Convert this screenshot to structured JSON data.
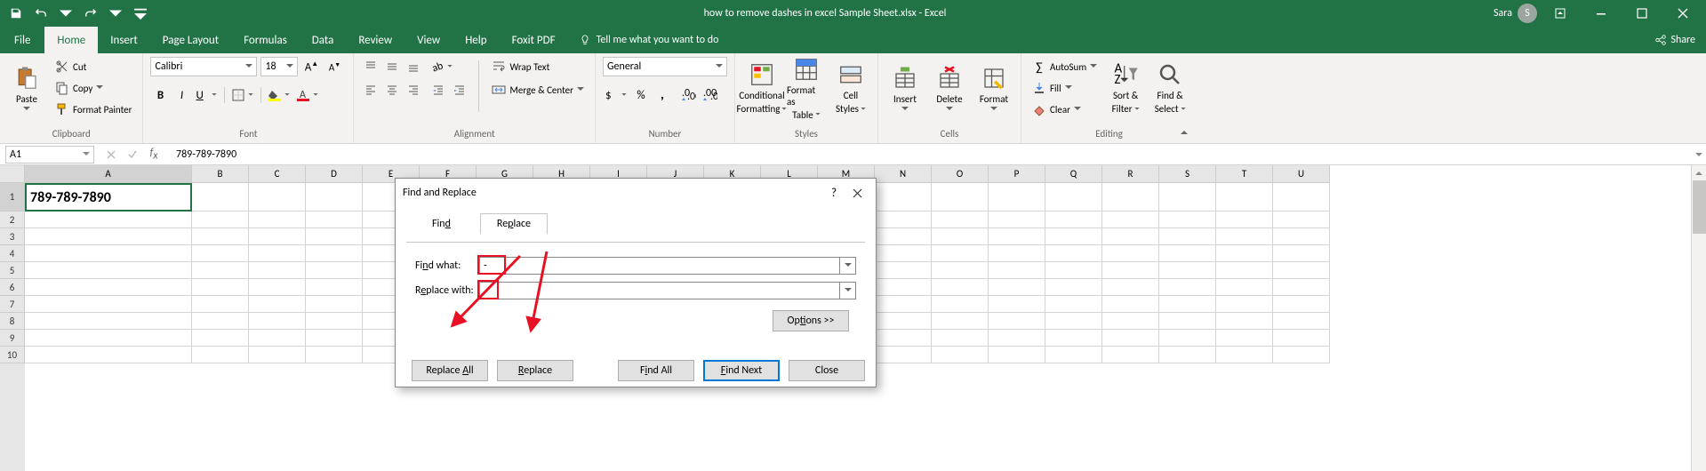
{
  "title": {
    "doc_name": "how to remove dashes in excel Sample Sheet.xlsx",
    "app_name": "Excel",
    "full": "how to remove dashes in excel Sample Sheet.xlsx  -  Excel"
  },
  "user": {
    "name": "Sara",
    "initial": "S"
  },
  "qat": {
    "save": "Save",
    "undo": "Undo",
    "redo": "Redo"
  },
  "tabs": {
    "file": "File",
    "home": "Home",
    "insert": "Insert",
    "page_layout": "Page Layout",
    "formulas": "Formulas",
    "data": "Data",
    "review": "Review",
    "view": "View",
    "help": "Help",
    "foxit": "Foxit PDF",
    "tell_me": "Tell me what you want to do"
  },
  "share": "Share",
  "ribbon": {
    "clipboard": {
      "paste": "Paste",
      "cut": "Cut",
      "copy": "Copy",
      "format_painter": "Format Painter",
      "label": "Clipboard"
    },
    "font": {
      "name": "Calibri",
      "size": "18",
      "label": "Font",
      "bold": "B",
      "italic": "I",
      "underline": "U"
    },
    "alignment": {
      "wrap": "Wrap Text",
      "merge": "Merge & Center",
      "label": "Alignment"
    },
    "number": {
      "format": "General",
      "label": "Number"
    },
    "styles": {
      "cond": "Conditional",
      "cond2": "Formatting",
      "format_table": "Format as",
      "format_table2": "Table",
      "cell_styles": "Cell",
      "cell_styles2": "Styles",
      "label": "Styles"
    },
    "cells": {
      "insert": "Insert",
      "delete": "Delete",
      "format": "Format",
      "label": "Cells"
    },
    "editing": {
      "autosum": "AutoSum",
      "fill": "Fill",
      "clear": "Clear",
      "sort": "Sort &",
      "sort2": "Filter",
      "find": "Find &",
      "find2": "Select",
      "label": "Editing"
    }
  },
  "formula_bar": {
    "namebox": "A1",
    "fx_value": "789-789-7890"
  },
  "grid": {
    "columns": [
      "A",
      "B",
      "C",
      "D",
      "E",
      "F",
      "G",
      "H",
      "I",
      "J",
      "K",
      "L",
      "M",
      "N",
      "O",
      "P",
      "Q",
      "R",
      "S",
      "T",
      "U"
    ],
    "rows": [
      1,
      2,
      3,
      4,
      5,
      6,
      7,
      8,
      9,
      10
    ],
    "a1": "789-789-7890"
  },
  "dialog": {
    "title": "Find and Replace",
    "tabs": {
      "find": "Find",
      "replace": "Replace"
    },
    "find_label_pre": "Fi",
    "find_label_key": "n",
    "find_label_post": "d what:",
    "replace_label_pre": "R",
    "replace_label_key": "e",
    "replace_label_post": "place with:",
    "find_value": "-",
    "replace_value": "",
    "options_pre": "Op",
    "options_key": "t",
    "options_post": "ions >>",
    "btn_replace_all_pre": "Replace ",
    "btn_replace_all_key": "A",
    "btn_replace_all_post": "ll",
    "btn_replace_key": "R",
    "btn_replace_post": "eplace",
    "btn_find_all_pre": "F",
    "btn_find_all_key": "i",
    "btn_find_all_post": "nd All",
    "btn_find_next_key": "F",
    "btn_find_next_post": "ind Next",
    "btn_close": "Close"
  }
}
